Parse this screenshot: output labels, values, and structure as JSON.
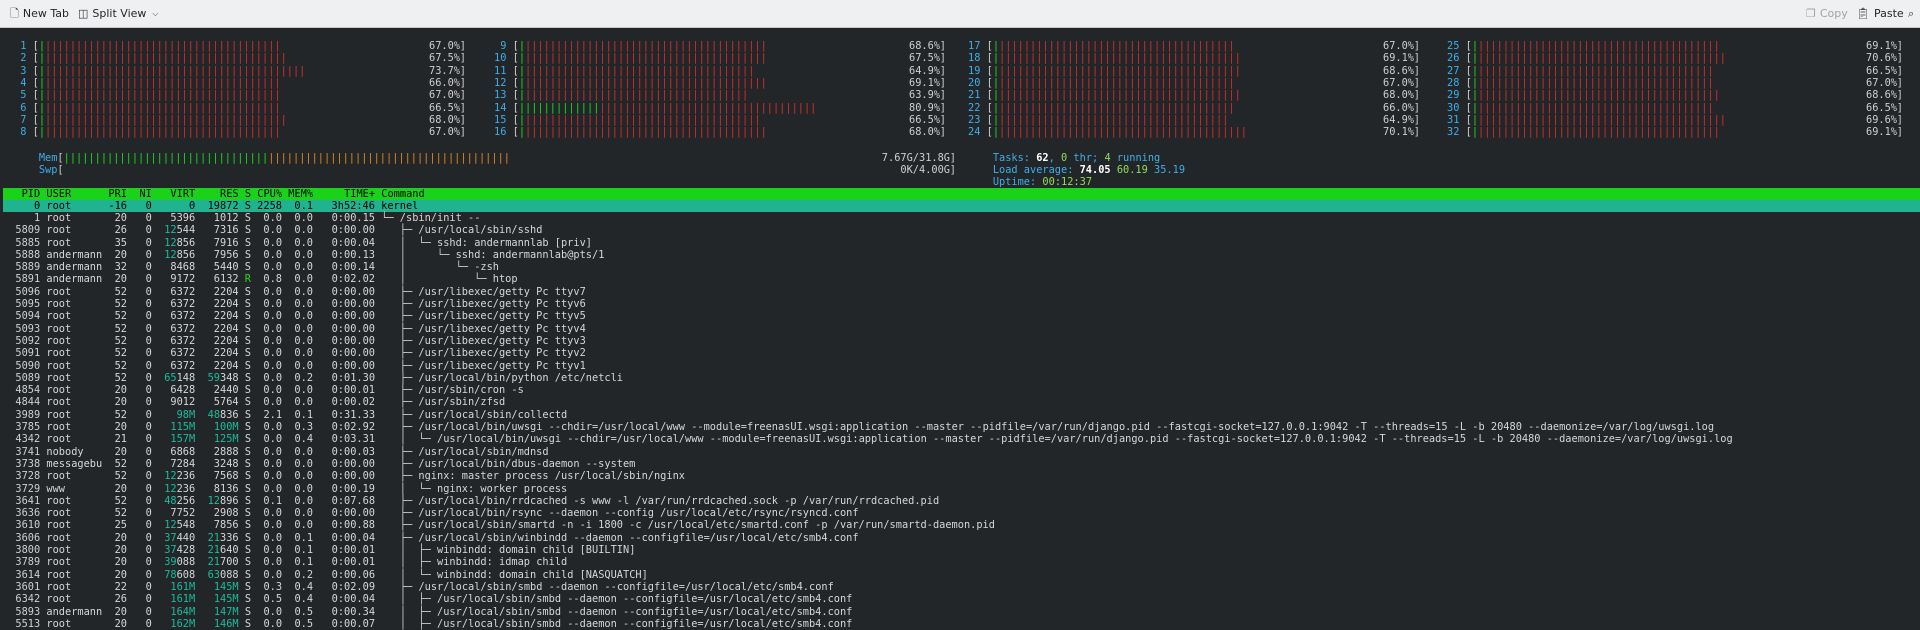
{
  "toolbar": {
    "new_tab": "New Tab",
    "split_view": "Split View",
    "copy": "Copy",
    "paste": "Paste"
  },
  "cpu_meters": [
    {
      "id": "1",
      "pct": "67.0%",
      "usage": 67.0
    },
    {
      "id": "2",
      "pct": "67.5%",
      "usage": 67.5
    },
    {
      "id": "3",
      "pct": "73.7%",
      "usage": 73.7
    },
    {
      "id": "4",
      "pct": "66.0%",
      "usage": 66.0
    },
    {
      "id": "5",
      "pct": "67.0%",
      "usage": 67.0
    },
    {
      "id": "6",
      "pct": "66.5%",
      "usage": 66.5
    },
    {
      "id": "7",
      "pct": "68.0%",
      "usage": 68.0
    },
    {
      "id": "8",
      "pct": "67.0%",
      "usage": 67.0
    },
    {
      "id": "9",
      "pct": "68.6%",
      "usage": 68.6
    },
    {
      "id": "10",
      "pct": "67.5%",
      "usage": 67.5
    },
    {
      "id": "11",
      "pct": "64.9%",
      "usage": 64.9
    },
    {
      "id": "12",
      "pct": "69.1%",
      "usage": 69.1
    },
    {
      "id": "13",
      "pct": "63.9%",
      "usage": 63.9
    },
    {
      "id": "14",
      "pct": "80.9%",
      "usage": 80.9
    },
    {
      "id": "15",
      "pct": "66.5%",
      "usage": 66.5
    },
    {
      "id": "16",
      "pct": "68.0%",
      "usage": 68.0
    },
    {
      "id": "17",
      "pct": "67.0%",
      "usage": 67.0
    },
    {
      "id": "18",
      "pct": "69.1%",
      "usage": 69.1
    },
    {
      "id": "19",
      "pct": "68.6%",
      "usage": 68.6
    },
    {
      "id": "20",
      "pct": "67.0%",
      "usage": 67.0
    },
    {
      "id": "21",
      "pct": "68.0%",
      "usage": 68.0
    },
    {
      "id": "22",
      "pct": "66.0%",
      "usage": 66.0
    },
    {
      "id": "23",
      "pct": "64.9%",
      "usage": 64.9
    },
    {
      "id": "24",
      "pct": "70.1%",
      "usage": 70.1
    },
    {
      "id": "25",
      "pct": "69.1%",
      "usage": 69.1
    },
    {
      "id": "26",
      "pct": "70.6%",
      "usage": 70.6
    },
    {
      "id": "27",
      "pct": "66.5%",
      "usage": 66.5
    },
    {
      "id": "28",
      "pct": "67.0%",
      "usage": 67.0
    },
    {
      "id": "29",
      "pct": "68.6%",
      "usage": 68.6
    },
    {
      "id": "30",
      "pct": "66.5%",
      "usage": 66.5
    },
    {
      "id": "31",
      "pct": "69.6%",
      "usage": 69.6
    },
    {
      "id": "32",
      "pct": "69.1%",
      "usage": 69.1
    }
  ],
  "mem": {
    "label": "Mem",
    "value": "7.67G/31.8G",
    "usage": 24.1
  },
  "swp": {
    "label": "Swp",
    "value": "0K/4.00G",
    "usage": 0
  },
  "tasks": {
    "label": "Tasks: ",
    "count": "62",
    "sep": ", ",
    "thr": "0",
    "thr_label": " thr; ",
    "running": "4",
    "running_label": " running"
  },
  "load": {
    "label": "Load average: ",
    "one": "74.05",
    "five": "60.19",
    "fifteen": "35.19"
  },
  "uptime": {
    "label": "Uptime: ",
    "value": "00:12:37"
  },
  "columns": [
    "PID",
    "USER",
    "PRI",
    "NI",
    "VIRT",
    "RES",
    "S",
    "CPU%",
    "MEM%",
    "TIME+",
    "Command"
  ],
  "selected": {
    "pid": "0",
    "user": "root",
    "pri": "-16",
    "ni": "0",
    "virt": "0",
    "res": "19872",
    "s": "S",
    "cpu": "2258",
    "mem": "0.1",
    "time": "3h52:46",
    "cmd": "kernel"
  },
  "processes": [
    {
      "pid": "1",
      "user": "root",
      "pri": "20",
      "ni": "0",
      "virt": "5396",
      "res": "1012",
      "s": "S",
      "cpu": "0.0",
      "mem": "0.0",
      "time": "0:00.15",
      "tree": "└─ ",
      "cmd": "/sbin/init --"
    },
    {
      "pid": "5809",
      "user": "root",
      "pri": "26",
      "ni": "0",
      "virt": "12544",
      "res": "7316",
      "s": "S",
      "cpu": "0.0",
      "mem": "0.0",
      "time": "0:00.00",
      "tree": "   ├─ ",
      "cmd": "/usr/local/sbin/sshd"
    },
    {
      "pid": "5885",
      "user": "root",
      "pri": "35",
      "ni": "0",
      "virt": "12856",
      "res": "7916",
      "s": "S",
      "cpu": "0.0",
      "mem": "0.0",
      "time": "0:00.04",
      "tree": "   │  └─ ",
      "cmd": "sshd: andermannlab [priv]"
    },
    {
      "pid": "5888",
      "user": "andermann",
      "pri": "20",
      "ni": "0",
      "virt": "12856",
      "res": "7956",
      "s": "S",
      "cpu": "0.0",
      "mem": "0.0",
      "time": "0:00.13",
      "tree": "   │     └─ ",
      "cmd": "sshd: andermannlab@pts/1"
    },
    {
      "pid": "5889",
      "user": "andermann",
      "pri": "32",
      "ni": "0",
      "virt": "8468",
      "res": "5440",
      "s": "S",
      "cpu": "0.0",
      "mem": "0.0",
      "time": "0:00.14",
      "tree": "   │        └─ ",
      "cmd": "-zsh"
    },
    {
      "pid": "5891",
      "user": "andermann",
      "pri": "20",
      "ni": "0",
      "virt": "9172",
      "res": "6132",
      "s": "R",
      "cpu": "0.8",
      "mem": "0.0",
      "time": "0:02.02",
      "tree": "   │           └─ ",
      "cmd": "htop"
    },
    {
      "pid": "5096",
      "user": "root",
      "pri": "52",
      "ni": "0",
      "virt": "6372",
      "res": "2204",
      "s": "S",
      "cpu": "0.0",
      "mem": "0.0",
      "time": "0:00.00",
      "tree": "   ├─ ",
      "cmd": "/usr/libexec/getty Pc ttyv7"
    },
    {
      "pid": "5095",
      "user": "root",
      "pri": "52",
      "ni": "0",
      "virt": "6372",
      "res": "2204",
      "s": "S",
      "cpu": "0.0",
      "mem": "0.0",
      "time": "0:00.00",
      "tree": "   ├─ ",
      "cmd": "/usr/libexec/getty Pc ttyv6"
    },
    {
      "pid": "5094",
      "user": "root",
      "pri": "52",
      "ni": "0",
      "virt": "6372",
      "res": "2204",
      "s": "S",
      "cpu": "0.0",
      "mem": "0.0",
      "time": "0:00.00",
      "tree": "   ├─ ",
      "cmd": "/usr/libexec/getty Pc ttyv5"
    },
    {
      "pid": "5093",
      "user": "root",
      "pri": "52",
      "ni": "0",
      "virt": "6372",
      "res": "2204",
      "s": "S",
      "cpu": "0.0",
      "mem": "0.0",
      "time": "0:00.00",
      "tree": "   ├─ ",
      "cmd": "/usr/libexec/getty Pc ttyv4"
    },
    {
      "pid": "5092",
      "user": "root",
      "pri": "52",
      "ni": "0",
      "virt": "6372",
      "res": "2204",
      "s": "S",
      "cpu": "0.0",
      "mem": "0.0",
      "time": "0:00.00",
      "tree": "   ├─ ",
      "cmd": "/usr/libexec/getty Pc ttyv3"
    },
    {
      "pid": "5091",
      "user": "root",
      "pri": "52",
      "ni": "0",
      "virt": "6372",
      "res": "2204",
      "s": "S",
      "cpu": "0.0",
      "mem": "0.0",
      "time": "0:00.00",
      "tree": "   ├─ ",
      "cmd": "/usr/libexec/getty Pc ttyv2"
    },
    {
      "pid": "5090",
      "user": "root",
      "pri": "52",
      "ni": "0",
      "virt": "6372",
      "res": "2204",
      "s": "S",
      "cpu": "0.0",
      "mem": "0.0",
      "time": "0:00.00",
      "tree": "   ├─ ",
      "cmd": "/usr/libexec/getty Pc ttyv1"
    },
    {
      "pid": "5089",
      "user": "root",
      "pri": "52",
      "ni": "0",
      "virt": "65148",
      "res": "59348",
      "s": "S",
      "cpu": "0.0",
      "mem": "0.2",
      "time": "0:01.30",
      "tree": "   ├─ ",
      "cmd": "/usr/local/bin/python /etc/netcli"
    },
    {
      "pid": "4854",
      "user": "root",
      "pri": "20",
      "ni": "0",
      "virt": "6428",
      "res": "2440",
      "s": "S",
      "cpu": "0.0",
      "mem": "0.0",
      "time": "0:00.01",
      "tree": "   ├─ ",
      "cmd": "/usr/sbin/cron -s"
    },
    {
      "pid": "4844",
      "user": "root",
      "pri": "20",
      "ni": "0",
      "virt": "9012",
      "res": "5764",
      "s": "S",
      "cpu": "0.0",
      "mem": "0.0",
      "time": "0:00.02",
      "tree": "   ├─ ",
      "cmd": "/usr/sbin/zfsd"
    },
    {
      "pid": "3989",
      "user": "root",
      "pri": "52",
      "ni": "0",
      "virt": "98M",
      "res": "48836",
      "s": "S",
      "cpu": "2.1",
      "mem": "0.1",
      "time": "0:31.33",
      "tree": "   ├─ ",
      "cmd": "/usr/local/sbin/collectd"
    },
    {
      "pid": "3785",
      "user": "root",
      "pri": "20",
      "ni": "0",
      "virt": "115M",
      "res": "100M",
      "s": "S",
      "cpu": "0.0",
      "mem": "0.3",
      "time": "0:02.92",
      "tree": "   ├─ ",
      "cmd": "/usr/local/bin/uwsgi --chdir=/usr/local/www --module=freenasUI.wsgi:application --master --pidfile=/var/run/django.pid --fastcgi-socket=127.0.0.1:9042 -T --threads=15 -L -b 20480 --daemonize=/var/log/uwsgi.log"
    },
    {
      "pid": "4342",
      "user": "root",
      "pri": "21",
      "ni": "0",
      "virt": "157M",
      "res": "125M",
      "s": "S",
      "cpu": "0.0",
      "mem": "0.4",
      "time": "0:03.31",
      "tree": "   │  └─ ",
      "cmd": "/usr/local/bin/uwsgi --chdir=/usr/local/www --module=freenasUI.wsgi:application --master --pidfile=/var/run/django.pid --fastcgi-socket=127.0.0.1:9042 -T --threads=15 -L -b 20480 --daemonize=/var/log/uwsgi.log"
    },
    {
      "pid": "3741",
      "user": "nobody",
      "pri": "20",
      "ni": "0",
      "virt": "6868",
      "res": "2888",
      "s": "S",
      "cpu": "0.0",
      "mem": "0.0",
      "time": "0:00.03",
      "tree": "   ├─ ",
      "cmd": "/usr/local/sbin/mdnsd"
    },
    {
      "pid": "3738",
      "user": "messagebu",
      "pri": "52",
      "ni": "0",
      "virt": "7284",
      "res": "3248",
      "s": "S",
      "cpu": "0.0",
      "mem": "0.0",
      "time": "0:00.00",
      "tree": "   ├─ ",
      "cmd": "/usr/local/bin/dbus-daemon --system"
    },
    {
      "pid": "3728",
      "user": "root",
      "pri": "52",
      "ni": "0",
      "virt": "12236",
      "res": "7568",
      "s": "S",
      "cpu": "0.0",
      "mem": "0.0",
      "time": "0:00.00",
      "tree": "   ├─ ",
      "cmd": "nginx: master process /usr/local/sbin/nginx"
    },
    {
      "pid": "3729",
      "user": "www",
      "pri": "20",
      "ni": "0",
      "virt": "12236",
      "res": "8136",
      "s": "S",
      "cpu": "0.0",
      "mem": "0.0",
      "time": "0:00.19",
      "tree": "   │  └─ ",
      "cmd": "nginx: worker process"
    },
    {
      "pid": "3641",
      "user": "root",
      "pri": "52",
      "ni": "0",
      "virt": "48256",
      "res": "12896",
      "s": "S",
      "cpu": "0.1",
      "mem": "0.0",
      "time": "0:07.68",
      "tree": "   ├─ ",
      "cmd": "/usr/local/bin/rrdcached -s www -l /var/run/rrdcached.sock -p /var/run/rrdcached.pid"
    },
    {
      "pid": "3636",
      "user": "root",
      "pri": "52",
      "ni": "0",
      "virt": "7752",
      "res": "2908",
      "s": "S",
      "cpu": "0.0",
      "mem": "0.0",
      "time": "0:00.00",
      "tree": "   ├─ ",
      "cmd": "/usr/local/bin/rsync --daemon --config /usr/local/etc/rsync/rsyncd.conf"
    },
    {
      "pid": "3610",
      "user": "root",
      "pri": "25",
      "ni": "0",
      "virt": "12548",
      "res": "7856",
      "s": "S",
      "cpu": "0.0",
      "mem": "0.0",
      "time": "0:00.88",
      "tree": "   ├─ ",
      "cmd": "/usr/local/sbin/smartd -n -i 1800 -c /usr/local/etc/smartd.conf -p /var/run/smartd-daemon.pid"
    },
    {
      "pid": "3606",
      "user": "root",
      "pri": "20",
      "ni": "0",
      "virt": "37440",
      "res": "21336",
      "s": "S",
      "cpu": "0.0",
      "mem": "0.1",
      "time": "0:00.04",
      "tree": "   ├─ ",
      "cmd": "/usr/local/sbin/winbindd --daemon --configfile=/usr/local/etc/smb4.conf"
    },
    {
      "pid": "3800",
      "user": "root",
      "pri": "20",
      "ni": "0",
      "virt": "37428",
      "res": "21640",
      "s": "S",
      "cpu": "0.0",
      "mem": "0.1",
      "time": "0:00.01",
      "tree": "   │  ├─ ",
      "cmd": "winbindd: domain child [BUILTIN]"
    },
    {
      "pid": "3789",
      "user": "root",
      "pri": "20",
      "ni": "0",
      "virt": "39088",
      "res": "21700",
      "s": "S",
      "cpu": "0.0",
      "mem": "0.1",
      "time": "0:00.01",
      "tree": "   │  ├─ ",
      "cmd": "winbindd: idmap child"
    },
    {
      "pid": "3614",
      "user": "root",
      "pri": "20",
      "ni": "0",
      "virt": "78608",
      "res": "63088",
      "s": "S",
      "cpu": "0.0",
      "mem": "0.2",
      "time": "0:00.06",
      "tree": "   │  └─ ",
      "cmd": "winbindd: domain child [NASQUATCH]"
    },
    {
      "pid": "3601",
      "user": "root",
      "pri": "22",
      "ni": "0",
      "virt": "161M",
      "res": "145M",
      "s": "S",
      "cpu": "0.3",
      "mem": "0.4",
      "time": "0:02.09",
      "tree": "   ├─ ",
      "cmd": "/usr/local/sbin/smbd --daemon --configfile=/usr/local/etc/smb4.conf"
    },
    {
      "pid": "6342",
      "user": "root",
      "pri": "26",
      "ni": "0",
      "virt": "161M",
      "res": "145M",
      "s": "S",
      "cpu": "0.5",
      "mem": "0.4",
      "time": "0:00.04",
      "tree": "   │  ├─ ",
      "cmd": "/usr/local/sbin/smbd --daemon --configfile=/usr/local/etc/smb4.conf"
    },
    {
      "pid": "5893",
      "user": "andermann",
      "pri": "20",
      "ni": "0",
      "virt": "164M",
      "res": "147M",
      "s": "S",
      "cpu": "0.0",
      "mem": "0.5",
      "time": "0:00.34",
      "tree": "   │  ├─ ",
      "cmd": "/usr/local/sbin/smbd --daemon --configfile=/usr/local/etc/smb4.conf"
    },
    {
      "pid": "5513",
      "user": "root",
      "pri": "20",
      "ni": "0",
      "virt": "162M",
      "res": "146M",
      "s": "S",
      "cpu": "0.0",
      "mem": "0.5",
      "time": "0:00.07",
      "tree": "   │  ├─ ",
      "cmd": "/usr/local/sbin/smbd --daemon --configfile=/usr/local/etc/smb4.conf"
    }
  ]
}
